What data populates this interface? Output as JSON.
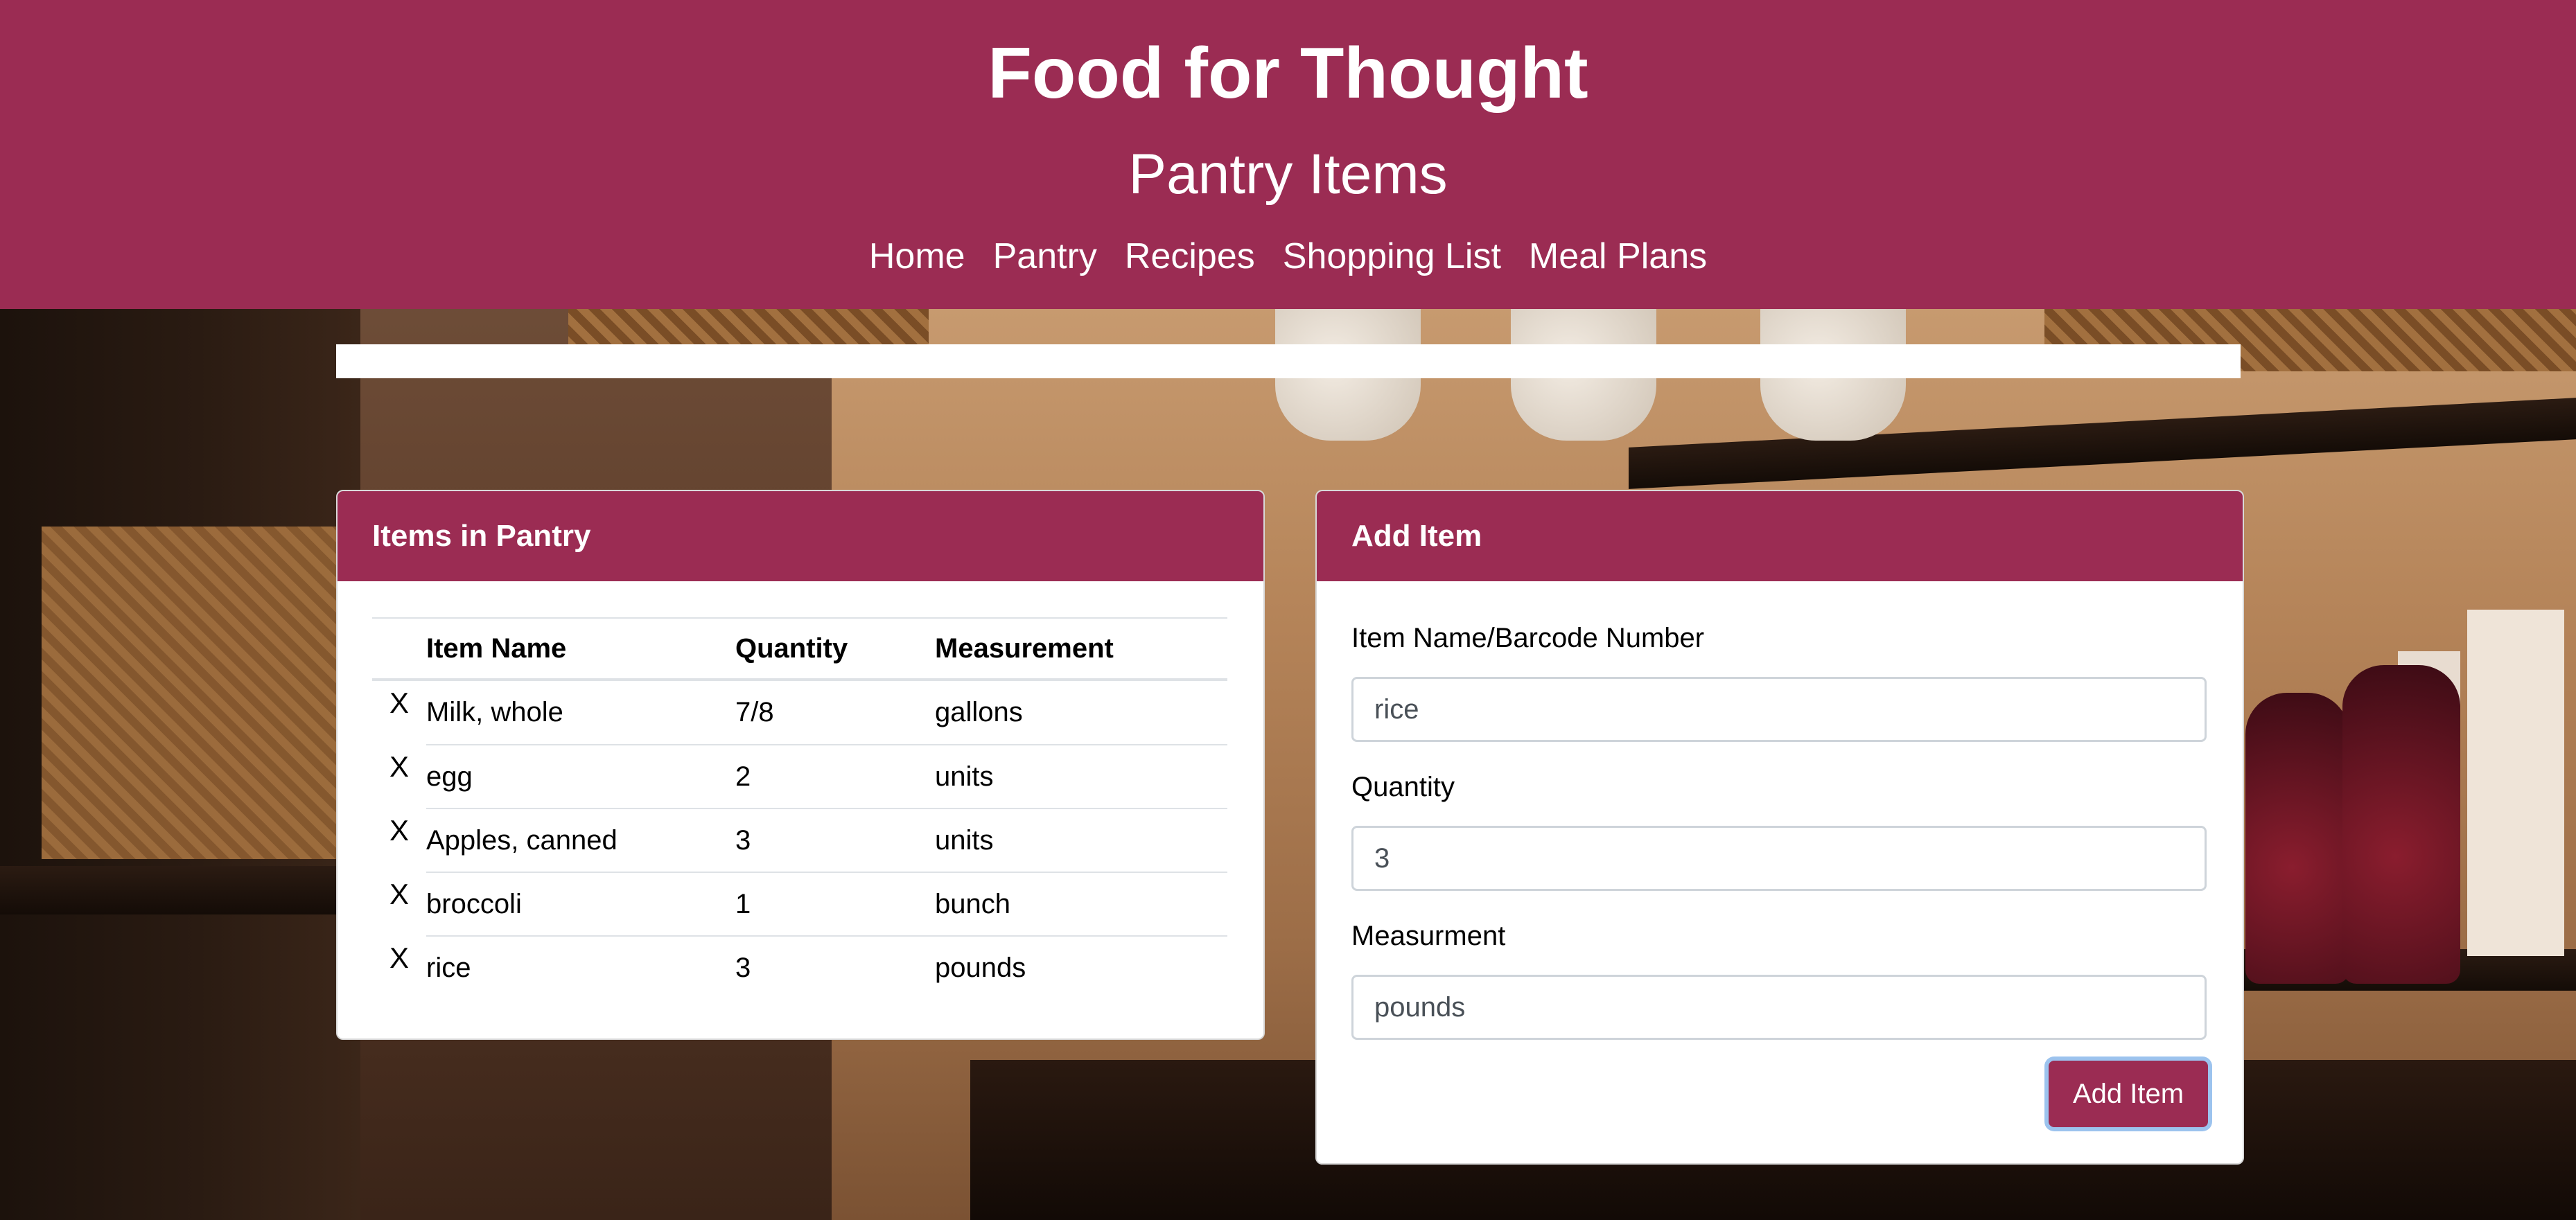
{
  "header": {
    "site_title": "Food for Thought",
    "page_subtitle": "Pantry Items",
    "nav": [
      "Home",
      "Pantry",
      "Recipes",
      "Shopping List",
      "Meal Plans"
    ]
  },
  "pantry": {
    "card_title": "Items in Pantry",
    "columns": [
      "Item Name",
      "Quantity",
      "Measurement"
    ],
    "delete_symbol": "X",
    "rows": [
      {
        "name": "Milk, whole",
        "quantity": "7/8",
        "measurement": "gallons"
      },
      {
        "name": "egg",
        "quantity": "2",
        "measurement": "units"
      },
      {
        "name": "Apples, canned",
        "quantity": "3",
        "measurement": "units"
      },
      {
        "name": "broccoli",
        "quantity": "1",
        "measurement": "bunch"
      },
      {
        "name": "rice",
        "quantity": "3",
        "measurement": "pounds"
      }
    ]
  },
  "add_item": {
    "card_title": "Add Item",
    "fields": {
      "name": {
        "label": "Item Name/Barcode Number",
        "value": "rice"
      },
      "quantity": {
        "label": "Quantity",
        "value": "3"
      },
      "measurement": {
        "label": "Measurment",
        "value": "pounds"
      }
    },
    "submit_label": "Add Item"
  },
  "colors": {
    "brand": "#9b2c53",
    "focus_ring": "#9cc3ee"
  }
}
